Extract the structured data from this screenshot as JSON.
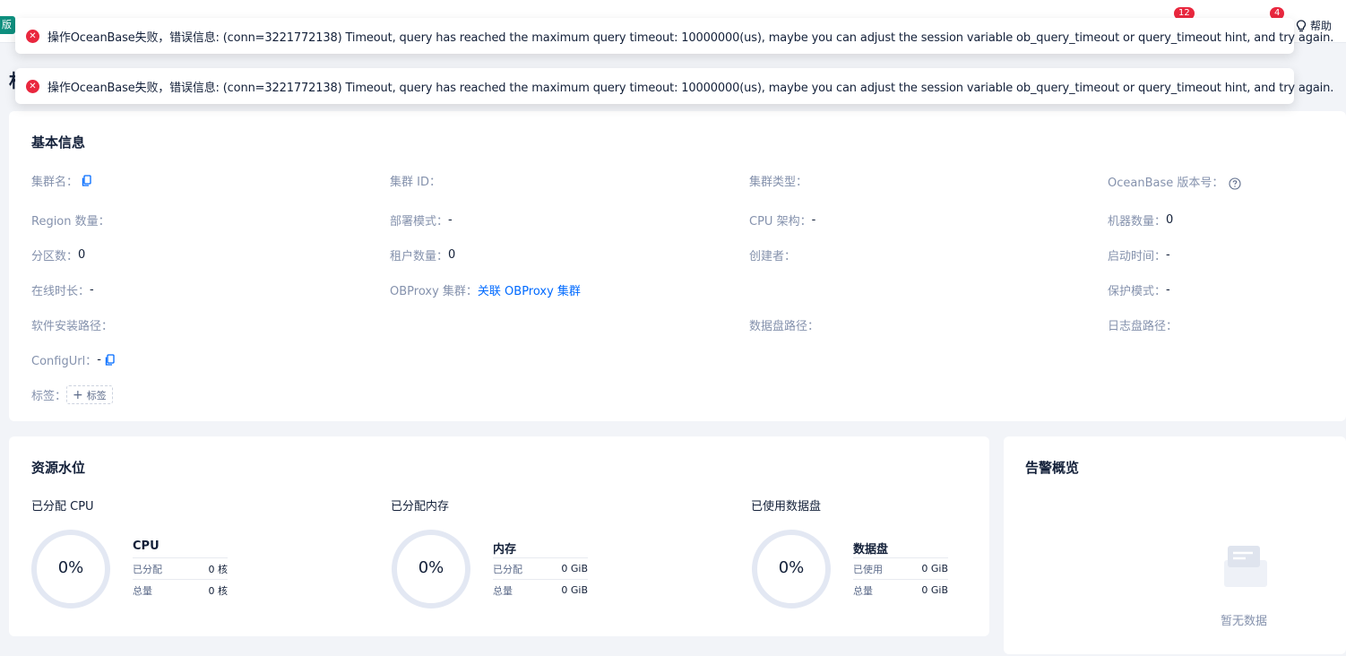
{
  "topbar": {
    "edition_tag": "版",
    "badge_left": "12",
    "badge_right": "4",
    "help_label": "帮助"
  },
  "page": {
    "title_fragment": "村"
  },
  "toasts": [
    "操作OceanBase失败，错误信息: (conn=3221772138) Timeout, query has reached the maximum query timeout: 10000000(us), maybe you can adjust the session variable ob_query_timeout or query_timeout hint, and try again.",
    "操作OceanBase失败，错误信息: (conn=3221772138) Timeout, query has reached the maximum query timeout: 10000000(us), maybe you can adjust the session variable ob_query_timeout or query_timeout hint, and try again."
  ],
  "basic_info": {
    "title": "基本信息",
    "cluster_name": {
      "label": "集群名：",
      "value": ""
    },
    "cluster_id": {
      "label": "集群 ID：",
      "value": ""
    },
    "cluster_type": {
      "label": "集群类型：",
      "value": ""
    },
    "ob_version": {
      "label": "OceanBase 版本号：",
      "value": ""
    },
    "region_count": {
      "label": "Region 数量：",
      "value": ""
    },
    "deploy_mode": {
      "label": "部署模式：",
      "value": "-"
    },
    "cpu_arch": {
      "label": "CPU 架构：",
      "value": "-"
    },
    "machine_count": {
      "label": "机器数量：",
      "value": "0"
    },
    "partition_count": {
      "label": "分区数：",
      "value": "0"
    },
    "tenant_count": {
      "label": "租户数量：",
      "value": "0"
    },
    "creator": {
      "label": "创建者：",
      "value": ""
    },
    "start_time": {
      "label": "启动时间：",
      "value": "-"
    },
    "online_duration": {
      "label": "在线时长：",
      "value": "-"
    },
    "obproxy_cluster": {
      "label": "OBProxy 集群：",
      "link": "关联 OBProxy 集群"
    },
    "protection_mode": {
      "label": "保护模式：",
      "value": "-"
    },
    "install_path": {
      "label": "软件安装路径：",
      "value": ""
    },
    "data_disk_path": {
      "label": "数据盘路径：",
      "value": ""
    },
    "log_disk_path": {
      "label": "日志盘路径：",
      "value": ""
    },
    "config_url": {
      "label": "ConfigUrl：",
      "value": "-"
    },
    "tags": {
      "label": "标签：",
      "add_label": "标签"
    }
  },
  "resource": {
    "title": "资源水位",
    "cpu": {
      "subtitle": "已分配 CPU",
      "percent": "0%",
      "percent_value": 0,
      "stat_title": "CPU",
      "rows": [
        {
          "k": "已分配",
          "v": "0 核"
        },
        {
          "k": "总量",
          "v": "0 核"
        }
      ]
    },
    "memory": {
      "subtitle": "已分配内存",
      "percent": "0%",
      "percent_value": 0,
      "stat_title": "内存",
      "rows": [
        {
          "k": "已分配",
          "v": "0 GiB"
        },
        {
          "k": "总量",
          "v": "0 GiB"
        }
      ]
    },
    "disk": {
      "subtitle": "已使用数据盘",
      "percent": "0%",
      "percent_value": 0,
      "stat_title": "数据盘",
      "rows": [
        {
          "k": "已使用",
          "v": "0 GiB"
        },
        {
          "k": "总量",
          "v": "0 GiB"
        }
      ]
    }
  },
  "alerts": {
    "title": "告警概览",
    "empty_text": "暂无数据"
  },
  "colors": {
    "accent": "#006aff",
    "error": "#e9273e",
    "donut_track": "#e3e8f3",
    "edition": "#0e8f7e"
  }
}
